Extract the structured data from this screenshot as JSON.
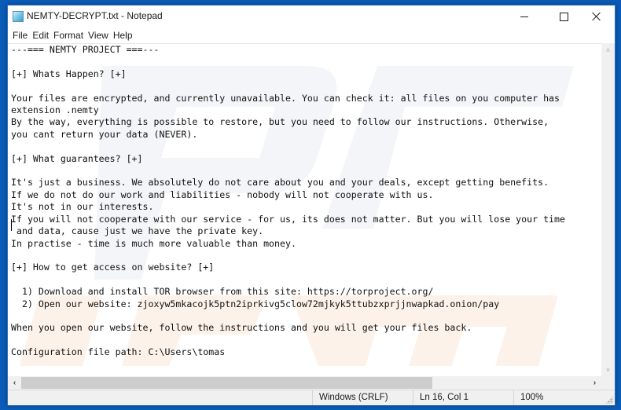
{
  "window": {
    "title": "NEMTY-DECRYPT.txt - Notepad",
    "icon": "notepad-icon",
    "controls": {
      "minimize": "minimize-icon",
      "maximize": "maximize-icon",
      "close": "close-icon"
    }
  },
  "menubar": {
    "items": [
      {
        "label": "File"
      },
      {
        "label": "Edit"
      },
      {
        "label": "Format"
      },
      {
        "label": "View"
      },
      {
        "label": "Help"
      }
    ]
  },
  "document": {
    "content": "---=== NEMTY PROJECT ===---\n\n[+] Whats Happen? [+]\n\nYour files are encrypted, and currently unavailable. You can check it: all files on you computer has\nextension .nemty\nBy the way, everything is possible to restore, but you need to follow our instructions. Otherwise,\nyou cant return your data (NEVER).\n\n[+] What guarantees? [+]\n\nIt's just a business. We absolutely do not care about you and your deals, except getting benefits.\nIf we do not do our work and liabilities - nobody will not cooperate with us.\nIt's not in our interests.\nIf you will not cooperate with our service - for us, its does not matter. But you will lose your time\n and data, cause just we have the private key.\nIn practise - time is much more valuable than money.\n\n[+] How to get access on website? [+]\n\n  1) Download and install TOR browser from this site: https://torproject.org/\n  2) Open our website: zjoxyw5mkacojk5ptn2iprkivg5clow72mjkyk5ttubzxprjjnwapkad.onion/pay\n\nWhen you open our website, follow the instructions and you will get your files back.\n\nConfiguration file path: C:\\Users\\tomas"
  },
  "scrollbars": {
    "vertical": {
      "up": "chevron-up-icon",
      "down": "chevron-down-icon"
    },
    "horizontal": {
      "left": "chevron-left-icon",
      "right": "chevron-right-icon",
      "left_glyph": "‹",
      "right_glyph": "›",
      "up_glyph": "˄",
      "down_glyph": "˅"
    }
  },
  "statusbar": {
    "line_ending": "Windows (CRLF)",
    "position": "Ln 16, Col 1",
    "zoom": "100%"
  }
}
